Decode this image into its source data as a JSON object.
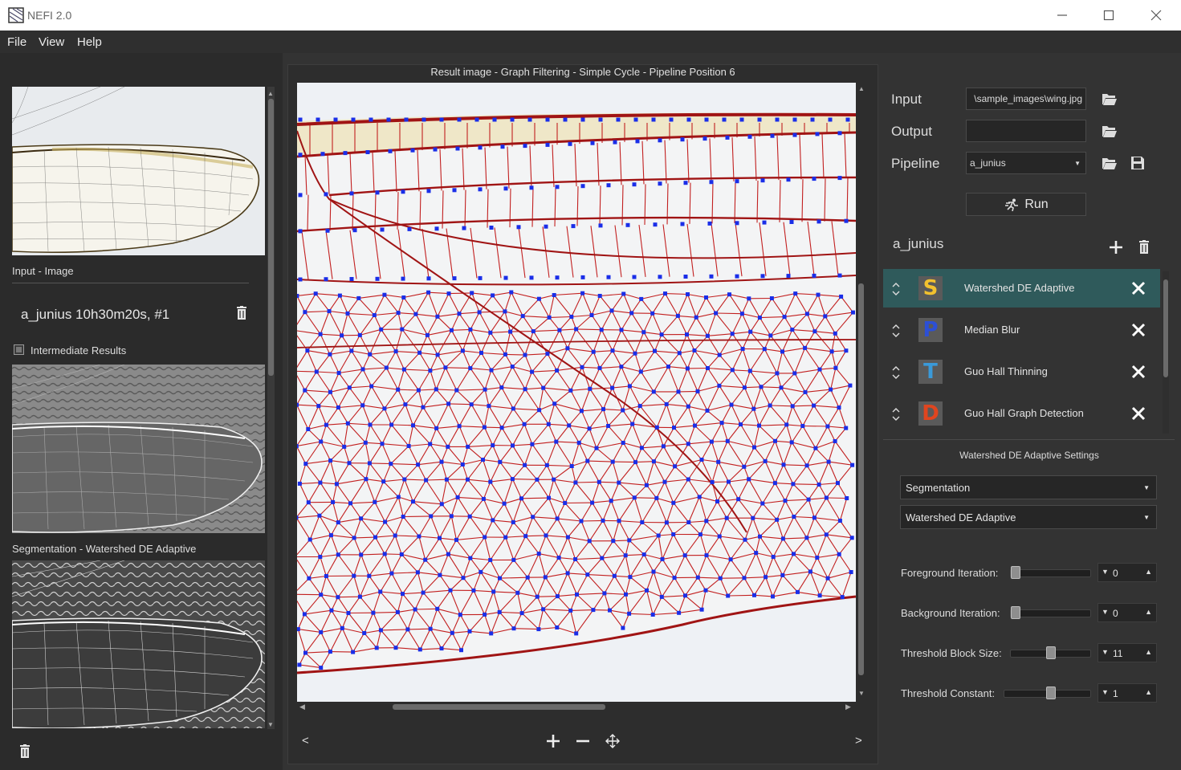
{
  "window": {
    "title": "NEFI 2.0"
  },
  "menu": [
    "File",
    "View",
    "Help"
  ],
  "left": {
    "input_label": "Input - Image",
    "run_name": "a_junius 10h30m20s, #1",
    "intermediate_label": "Intermediate Results",
    "intermediate_checked": false,
    "segmentation_label": "Segmentation - Watershed DE Adaptive"
  },
  "center": {
    "title": "Result image - Graph Filtering - Simple Cycle - Pipeline Position 6",
    "prev": "<",
    "next": ">"
  },
  "io": {
    "input_label": "Input",
    "input_value": "\\sample_images\\wing.jpg",
    "output_label": "Output",
    "output_value": "",
    "pipeline_label": "Pipeline",
    "pipeline_value": "a_junius",
    "run_label": "Run"
  },
  "pipeline": {
    "name": "a_junius",
    "steps": [
      {
        "letter": "S",
        "name": "Watershed DE Adaptive",
        "color": "#f2c12e",
        "selected": true
      },
      {
        "letter": "P",
        "name": "Median Blur",
        "color": "#2c4fd6",
        "selected": false
      },
      {
        "letter": "T",
        "name": "Guo Hall Thinning",
        "color": "#3a9ad9",
        "selected": false
      },
      {
        "letter": "D",
        "name": "Guo Hall Graph Detection",
        "color": "#e0451f",
        "selected": false
      }
    ]
  },
  "settings": {
    "title": "Watershed DE Adaptive Settings",
    "category": "Segmentation",
    "algorithm": "Watershed DE Adaptive",
    "params": [
      {
        "label": "Foreground Iteration:",
        "value": "0",
        "level": 0.0
      },
      {
        "label": "Background Iteration:",
        "value": "0",
        "level": 0.0
      },
      {
        "label": "Threshold Block Size:",
        "value": "11",
        "level": 0.5
      },
      {
        "label": "Threshold Constant:",
        "value": "1",
        "level": 0.55
      }
    ]
  },
  "colors": {
    "selected_row": "#2f5a5b",
    "accent_red": "#c21f1f",
    "node_blue": "#1a2ee8"
  }
}
